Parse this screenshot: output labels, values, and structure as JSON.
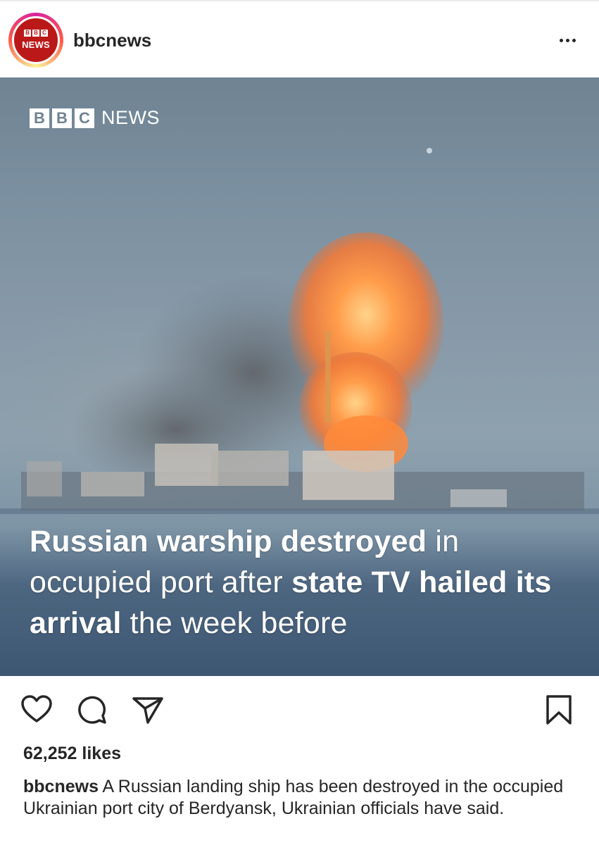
{
  "post": {
    "username": "bbcnews",
    "avatar": {
      "brand_letters": [
        "B",
        "B",
        "C"
      ],
      "brand_word": "NEWS",
      "brand_color": "#bb1919"
    },
    "more_icon": "more-horizontal-icon"
  },
  "media": {
    "watermark": {
      "letters": [
        "B",
        "B",
        "C"
      ],
      "word": "NEWS"
    },
    "headline": {
      "bold_1": "Russian warship destroyed",
      "normal_1": " in occupied port after ",
      "bold_2": "state TV hailed its arrival",
      "normal_2": " the week before"
    }
  },
  "actions": {
    "like_icon": "heart-icon",
    "comment_icon": "comment-icon",
    "share_icon": "paper-plane-icon",
    "save_icon": "bookmark-icon"
  },
  "likes": "62,252 likes",
  "caption": {
    "user": "bbcnews",
    "text": " A Russian landing ship has been destroyed in the occupied Ukrainian port city of Berdyansk, Ukrainian officials have said."
  }
}
